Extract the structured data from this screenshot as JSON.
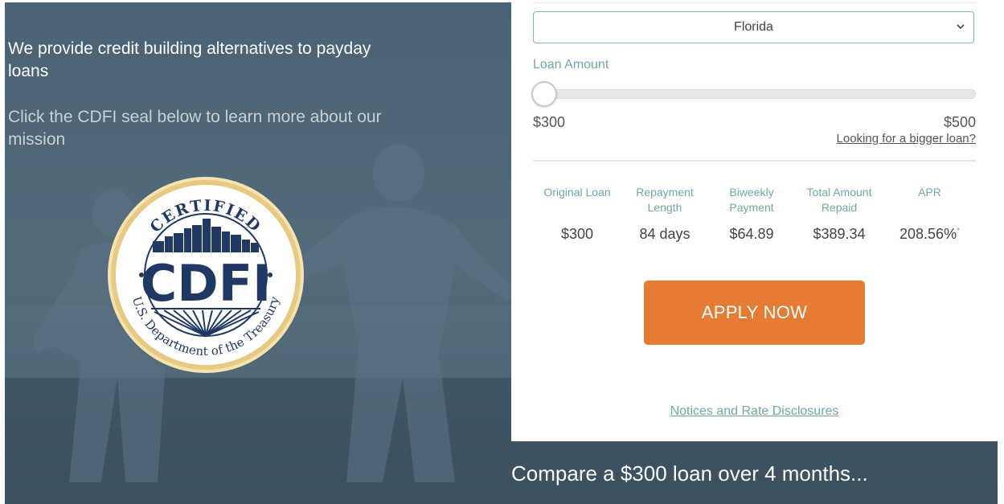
{
  "hero": {
    "tagline": "We provide credit building alternatives to payday loans",
    "mission": "Click the CDFI seal below to learn more about our mission"
  },
  "seal": {
    "top_text": "CERTIFIED",
    "center_text": "CDFI",
    "bottom_text": "U.S. Department of the Treasury",
    "ring_color": "#e7c982",
    "navy": "#1f3864"
  },
  "calculator": {
    "state": "Florida",
    "loan_amount_label": "Loan Amount",
    "min_label": "$300",
    "max_label": "$500",
    "slider_level": 0,
    "bigger_loan_link": "Looking for a bigger loan?",
    "summary": [
      {
        "head": "Original Loan",
        "value": "$300"
      },
      {
        "head": "Repayment Length",
        "value": "84 days"
      },
      {
        "head": "Biweekly Payment",
        "value": "$64.89"
      },
      {
        "head": "Total Amount Repaid",
        "value": "$389.34"
      },
      {
        "head": "APR",
        "value": "208.56%"
      }
    ],
    "apr_marker": "*",
    "apply_label": "APPLY NOW",
    "notices_link": "Notices and Rate Disclosures"
  },
  "compare_text": "Compare a $300 loan over 4 months...",
  "colors": {
    "hero_bg": "#4a6070",
    "accent_teal": "#6fa8a5",
    "apply_orange": "#e67b34"
  }
}
